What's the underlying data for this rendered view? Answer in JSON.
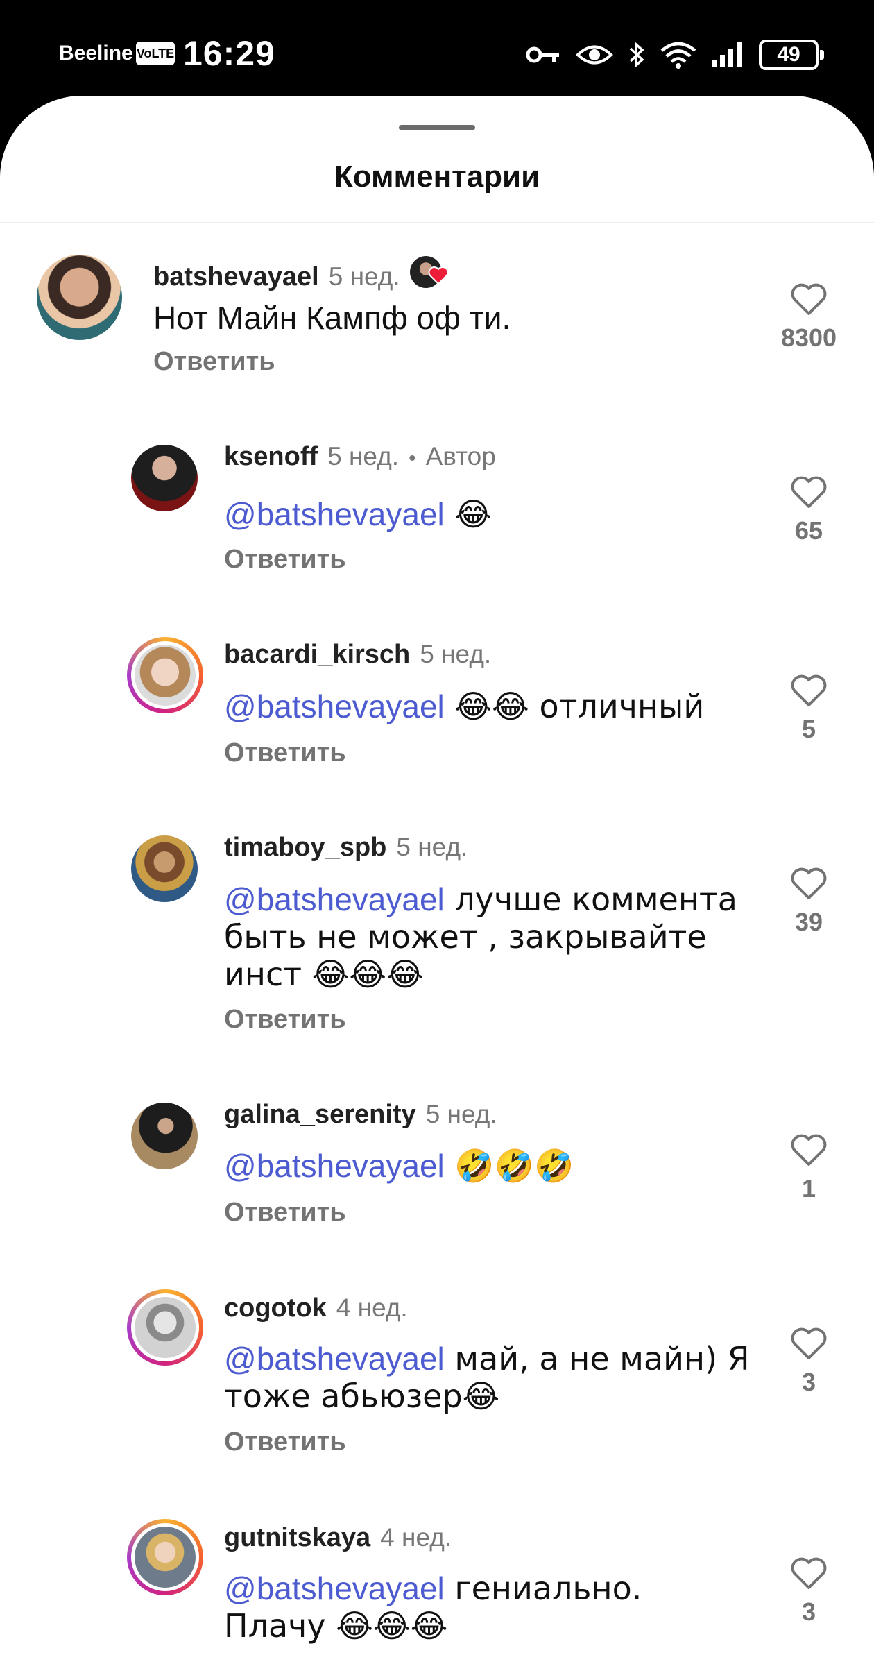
{
  "status": {
    "carrier": "Beeline",
    "volte": "VoLTE",
    "time": "16:29",
    "battery": "49"
  },
  "sheet": {
    "title": "Комментарии"
  },
  "reply_label": "Ответить",
  "comments": [
    {
      "username": "batshevayael",
      "time": "5 нед.",
      "text": "Нот Майн Кампф оф ти.",
      "likes": "8300"
    },
    {
      "username": "ksenoff",
      "time": "5 нед.",
      "author_badge": "Автор",
      "mention": "@batshevayael",
      "text": " 😂",
      "likes": "65"
    },
    {
      "username": "bacardi_kirsch",
      "time": "5 нед.",
      "mention": "@batshevayael",
      "text": " 😂😂 отличный",
      "likes": "5"
    },
    {
      "username": "timaboy_spb",
      "time": "5 нед.",
      "mention": "@batshevayael",
      "text": " лучше коммента быть не может , закрывайте инст 😂😂😂",
      "likes": "39"
    },
    {
      "username": "galina_serenity",
      "time": "5 нед.",
      "mention": "@batshevayael",
      "text": " 🤣🤣🤣",
      "likes": "1"
    },
    {
      "username": "cogotok",
      "time": "4 нед.",
      "mention": "@batshevayael",
      "text": " май, а не майн) Я тоже абьюзер😂",
      "likes": "3"
    },
    {
      "username": "gutnitskaya",
      "time": "4 нед.",
      "mention": "@batshevayael",
      "text": " гениально.  Плачу 😂😂😂",
      "likes": "3"
    }
  ],
  "colors": {
    "mention": "#4d5bd0",
    "secondary_text": "#737373",
    "heart_badge": "#ed1c38"
  }
}
